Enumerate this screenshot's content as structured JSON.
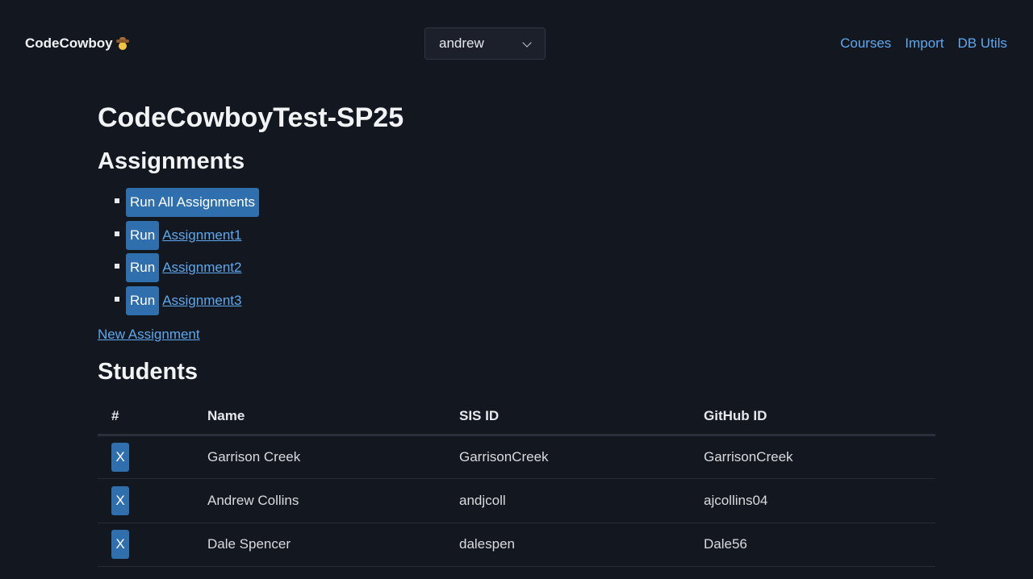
{
  "app": {
    "brand": "CodeCowboy",
    "brand_icon": "cowboy-hat-face-icon"
  },
  "user_select": {
    "value": "andrew"
  },
  "nav": {
    "courses": "Courses",
    "import": "Import",
    "db_utils": "DB Utils"
  },
  "course": {
    "title": "CodeCowboyTest-SP25"
  },
  "assignments": {
    "heading": "Assignments",
    "run_all_label": "Run All Assignments",
    "items": [
      {
        "run_label": "Run",
        "name": "Assignment1"
      },
      {
        "run_label": "Run",
        "name": "Assignment2"
      },
      {
        "run_label": "Run",
        "name": "Assignment3"
      }
    ],
    "new_label": "New Assignment"
  },
  "students": {
    "heading": "Students",
    "columns": [
      "#",
      "Name",
      "SIS ID",
      "GitHub ID"
    ],
    "rows": [
      {
        "delete_label": "X",
        "name": "Garrison Creek",
        "sis_id": "GarrisonCreek",
        "github_id": "GarrisonCreek"
      },
      {
        "delete_label": "X",
        "name": "Andrew Collins",
        "sis_id": "andjcoll",
        "github_id": "ajcollins04"
      },
      {
        "delete_label": "X",
        "name": "Dale Spencer",
        "sis_id": "dalespen",
        "github_id": "Dale56"
      }
    ]
  },
  "colors": {
    "background": "#13171f",
    "accent": "#2f6fad",
    "link": "#5ea8ef"
  }
}
